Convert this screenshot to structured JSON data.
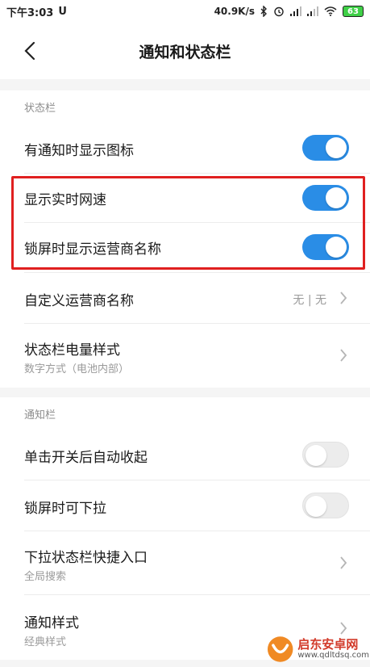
{
  "status_bar": {
    "time": "下午3:03",
    "left_extra": "U",
    "net_speed": "40.9K/s",
    "battery": "63"
  },
  "header": {
    "title": "通知和状态栏"
  },
  "sections": {
    "statusbar_title": "状态栏",
    "notification_title": "通知栏"
  },
  "rows": {
    "notify_icon": {
      "label": "有通知时显示图标",
      "enabled": true
    },
    "net_speed": {
      "label": "显示实时网速",
      "enabled": true
    },
    "carrier_lock": {
      "label": "锁屏时显示运营商名称",
      "enabled": true
    },
    "custom_carrier": {
      "label": "自定义运营商名称",
      "value": "无 | 无"
    },
    "battery_style": {
      "label": "状态栏电量样式",
      "sub": "数字方式（电池内部）"
    },
    "auto_collapse": {
      "label": "单击开关后自动收起",
      "enabled": false
    },
    "lock_pull": {
      "label": "锁屏时可下拉",
      "enabled": false
    },
    "quick_entry": {
      "label": "下拉状态栏快捷入口",
      "sub": "全局搜索"
    },
    "notify_style": {
      "label": "通知样式",
      "sub": "经典样式"
    }
  },
  "watermark": {
    "brand": "启东安卓网",
    "url": "www.qdltdsq.com"
  },
  "colors": {
    "accent": "#2a8de6",
    "highlight": "#e02020"
  }
}
